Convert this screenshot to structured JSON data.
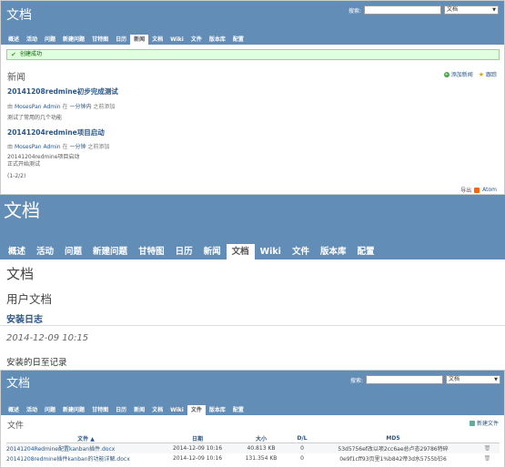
{
  "nav_tabs": [
    "概述",
    "活动",
    "问题",
    "新建问题",
    "甘特图",
    "日历",
    "新闻",
    "文档",
    "Wiki",
    "文件",
    "版本库",
    "配置"
  ],
  "search": {
    "label": "搜索:",
    "scope": "文档"
  },
  "pane1": {
    "title": "文档",
    "selected_tab": "新闻",
    "flash": "创建成功",
    "heading": "新闻",
    "add_news": "添加新闻",
    "watch": "跟踪",
    "news": [
      {
        "title": "20141208redmine初步完成测试",
        "by": "由",
        "author": "MosesPan Admin",
        "in": "在",
        "ago": "一分钟内",
        "added": "之前添加",
        "desc": "测试了常用的几个功能"
      },
      {
        "title": "20141204redmine项目启动",
        "by": "由",
        "author": "MosesPan Admin",
        "in": "在",
        "ago": "一分钟",
        "added": "之前添加",
        "desc": "20141204redmine项目启动\n正式开始测试"
      }
    ],
    "pagination": "(1-2/2)",
    "export": "导出",
    "atom": "Atom"
  },
  "pane2": {
    "title": "文档",
    "selected_tab": "文档",
    "heading": "文档",
    "category": "用户文档",
    "doc_title": "安装日志",
    "doc_date": "2014-12-09 10:15",
    "doc_desc": "安装的日至记录"
  },
  "pane3": {
    "title": "文档",
    "selected_tab": "文件",
    "heading": "文件",
    "new_file": "新建文件",
    "columns": [
      "文件 ▲",
      "日期",
      "大小",
      "D/L",
      "MD5"
    ],
    "files": [
      {
        "name": "20141204Redmine配置kanban插件.docx",
        "date": "2014-12-09 10:16",
        "size": "40.813 KB",
        "dl": "0",
        "md5": "53d5756ef改以项2cc6ae总卢态29786特碎"
      },
      {
        "name": "20141208redmine插件kanban的功能详解.docx",
        "date": "2014-12-09 10:16",
        "size": "131.354 KB",
        "dl": "0",
        "md5": "0e9f1cff93页里1%b842帝3d水5755b钐6"
      }
    ]
  },
  "colors": {
    "header": "#628db6",
    "link": "#2a5685",
    "flash_bg": "#dfffdf"
  }
}
